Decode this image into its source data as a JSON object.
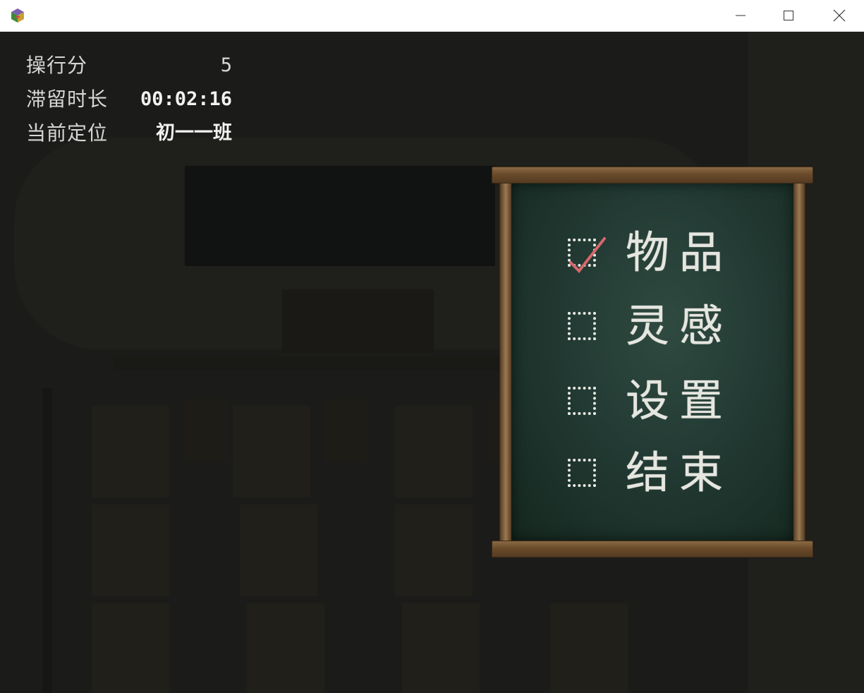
{
  "window": {
    "icons": [
      "app-icon",
      "minimize-icon",
      "maximize-icon",
      "close-icon"
    ]
  },
  "hud": {
    "conduct_label": "操行分",
    "conduct_value": "5",
    "duration_label": "滞留时长",
    "duration_value": "00:02:16",
    "location_label": "当前定位",
    "location_value": "初一一班"
  },
  "menu": {
    "items": [
      {
        "label": "物品",
        "checked": true
      },
      {
        "label": "灵感",
        "checked": false
      },
      {
        "label": "设置",
        "checked": false
      },
      {
        "label": "结束",
        "checked": false
      }
    ]
  },
  "colors": {
    "background": "#1b1b19",
    "chalkboard": "#223a33",
    "frame_wood": "#6a4b2b",
    "chalk": "#e6e6e0",
    "checkmark": "#d9676c"
  }
}
